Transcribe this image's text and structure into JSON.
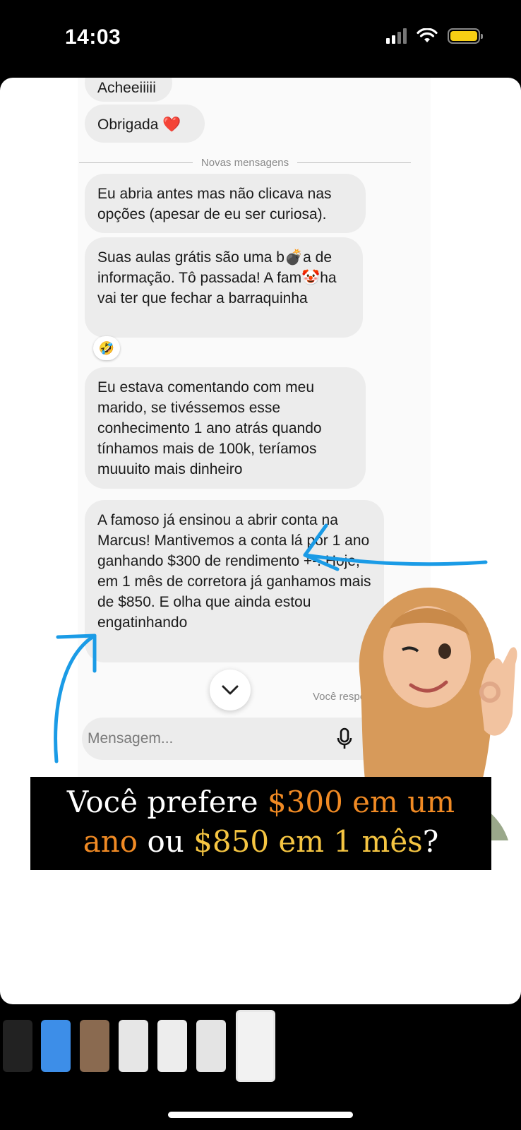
{
  "status_bar": {
    "time": "14:03"
  },
  "chat": {
    "messages": [
      {
        "text": "Acheeiiiii"
      },
      {
        "text": "Obrigada ❤️"
      },
      {
        "text": "Eu abria antes mas não clicava nas opções (apesar de eu ser curiosa)."
      },
      {
        "text": "Suas aulas grátis são uma b💣a de informação. Tô passada! A fam🤡ha vai ter que fechar a barraquinha"
      },
      {
        "text": "Eu estava comentando com meu marido, se tivéssemos esse conhecimento 1 ano atrás quando tínhamos mais de 100k, teríamos muuuito mais dinheiro"
      },
      {
        "text": "A famoso já ensinou a abrir conta na Marcus! Mantivemos a conta lá por 1 ano ganhando $300 de rendimento +-. Hoje, em 1 mês de corretora já ganhamos mais de $850. E olha que ainda estou engatinhando"
      }
    ],
    "divider_label": "Novas mensagens",
    "reaction_emoji": "🤣",
    "you_replied": "Você respondeu",
    "input_placeholder": "Mensagem...",
    "input_icons": [
      "microphone-icon",
      "image-icon",
      "sticker-icon"
    ]
  },
  "banner": {
    "part1": "Você prefere ",
    "part2": "$300 em um",
    "part3": "ano",
    "part4": " ou ",
    "part5": "$850 em 1 mês",
    "part6": "?"
  },
  "colors": {
    "arrow": "#1a9be6",
    "banner_orange": "#f08a24",
    "banner_yellow": "#f5c542",
    "bubble": "#ececec"
  },
  "thumbnails_count": 7
}
